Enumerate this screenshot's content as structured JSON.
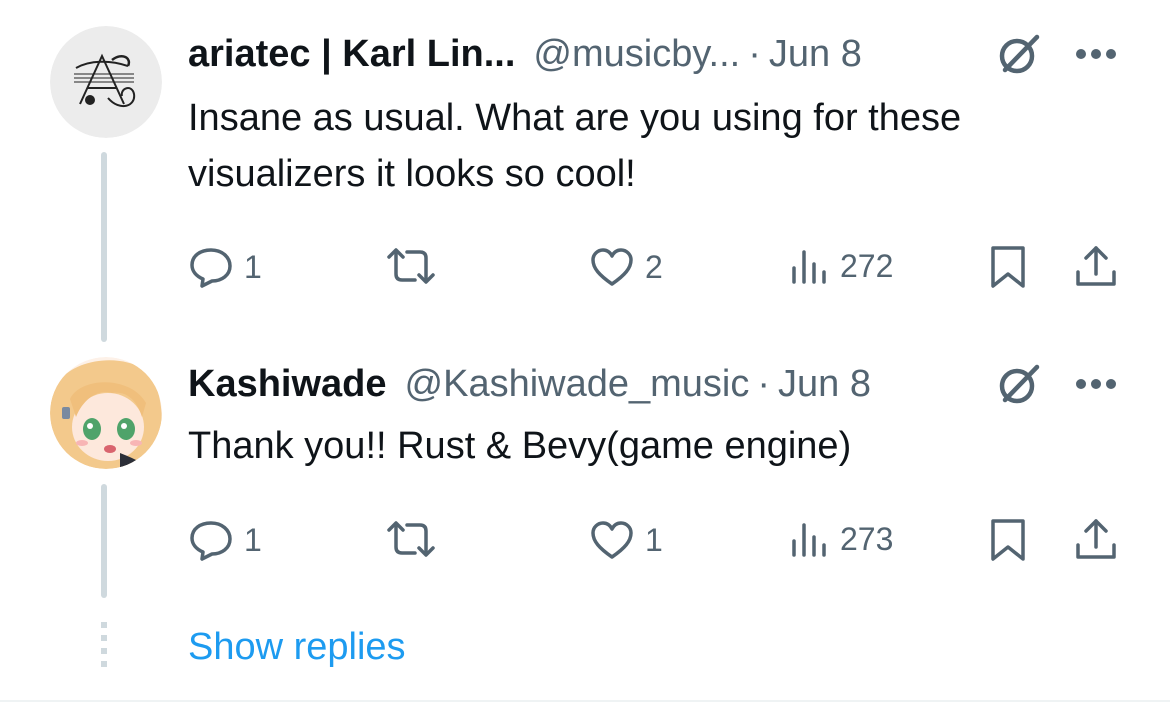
{
  "replies": [
    {
      "author_name": "ariatec | Karl Lin...",
      "handle": "@musicby...",
      "separator": "·",
      "date": "Jun 8",
      "text": "Insane as usual. What are you using for these visualizers it looks so cool!",
      "reply_count": "1",
      "like_count": "2",
      "view_count": "272",
      "avatar_icon": "ornate-letter-a-logo"
    },
    {
      "author_name": "Kashiwade",
      "handle": "@Kashiwade_music",
      "separator": "·",
      "date": "Jun 8",
      "text": "Thank you!! Rust & Bevy(game engine)",
      "reply_count": "1",
      "like_count": "1",
      "view_count": "273",
      "avatar_icon": "anime-girl-avatar"
    }
  ],
  "show_replies_label": "Show replies",
  "colors": {
    "text_primary": "#0f1419",
    "text_secondary": "#536471",
    "link": "#1d9bf0",
    "thread_line": "#cfd9de"
  }
}
